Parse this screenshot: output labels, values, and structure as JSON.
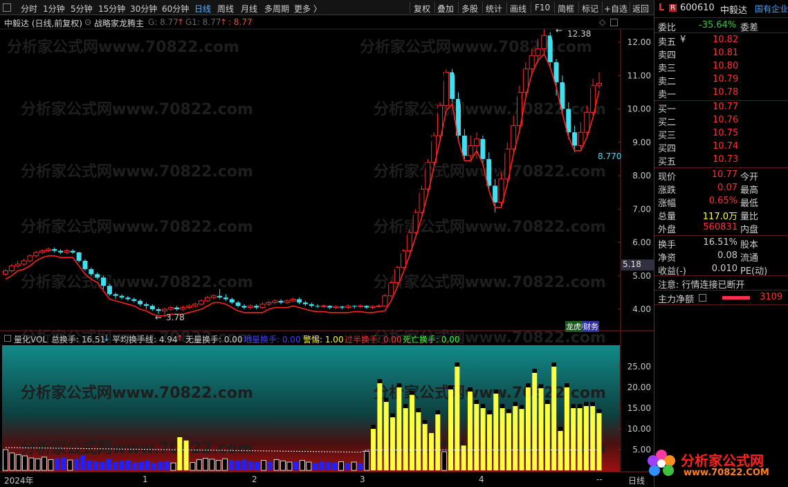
{
  "toolbar": {
    "periods": [
      "分时",
      "1分钟",
      "5分钟",
      "15分钟",
      "30分钟",
      "60分钟",
      "日线",
      "周线",
      "月线",
      "多周期",
      "更多 〉"
    ],
    "active_period": "日线",
    "actions": [
      "复权",
      "叠加",
      "多股",
      "统计",
      "画线",
      "F10",
      "简框",
      "标记",
      "+自选",
      "返回"
    ]
  },
  "chart_header": {
    "stock_label": "中毅达 (日线,前复权)",
    "indicator": "战略家龙腾主",
    "g_label": "G: 8.77",
    "g1_label": "G1: 8.77",
    "third_label": ": 8.77"
  },
  "main_chart": {
    "price_ticks": [
      "12.00",
      "11.00",
      "10.00",
      "9.00",
      "8.00",
      "7.00",
      "6.00",
      "5.00",
      "4.00"
    ],
    "price_ticks_values": [
      12,
      11,
      10,
      9,
      8,
      7,
      6,
      5,
      4
    ],
    "high_label": "12.38",
    "low_label": "3.78",
    "line_label": "8.770",
    "current_price_tag": "5.18",
    "badges": [
      "龙虎榜",
      "财务"
    ],
    "watermark": "分析家公式网www.70822.com",
    "colors": {
      "up": "#ff2a2a",
      "down": "#40e0f0",
      "black_line": "#000000",
      "red_line": "#ff2020"
    }
  },
  "chart_data": [
    {
      "type": "candlestick",
      "ylim": [
        3.6,
        12.8
      ],
      "series": [
        {
          "name": "candles",
          "values": [
            [
              5.05,
              5.15,
              5.2,
              5.0
            ],
            [
              5.15,
              5.3,
              5.35,
              5.1
            ],
            [
              5.3,
              5.35,
              5.45,
              5.25
            ],
            [
              5.35,
              5.45,
              5.5,
              5.3
            ],
            [
              5.45,
              5.6,
              5.65,
              5.4
            ],
            [
              5.6,
              5.7,
              5.75,
              5.55
            ],
            [
              5.7,
              5.75,
              5.8,
              5.65
            ],
            [
              5.75,
              5.8,
              5.85,
              5.7
            ],
            [
              5.8,
              5.75,
              5.85,
              5.7
            ],
            [
              5.75,
              5.7,
              5.8,
              5.65
            ],
            [
              5.7,
              5.75,
              5.8,
              5.65
            ],
            [
              5.75,
              5.7,
              5.8,
              5.65
            ],
            [
              5.7,
              5.45,
              5.72,
              5.4
            ],
            [
              5.45,
              5.2,
              5.5,
              5.15
            ],
            [
              5.2,
              5.05,
              5.25,
              5.0
            ],
            [
              5.05,
              4.95,
              5.1,
              4.9
            ],
            [
              4.95,
              4.7,
              5.0,
              4.6
            ],
            [
              4.7,
              4.45,
              4.75,
              4.4
            ],
            [
              4.45,
              4.4,
              4.5,
              4.3
            ],
            [
              4.4,
              4.35,
              4.45,
              4.3
            ],
            [
              4.35,
              4.3,
              4.4,
              4.25
            ],
            [
              4.3,
              4.25,
              4.35,
              4.2
            ],
            [
              4.25,
              4.15,
              4.3,
              4.1
            ],
            [
              4.15,
              4.1,
              4.2,
              4.0
            ],
            [
              4.1,
              4.0,
              4.15,
              3.95
            ],
            [
              4.0,
              3.95,
              4.05,
              3.85
            ],
            [
              3.95,
              4.0,
              4.05,
              3.78
            ],
            [
              4.0,
              4.05,
              4.1,
              3.95
            ],
            [
              4.05,
              4.0,
              4.1,
              3.95
            ],
            [
              4.0,
              4.05,
              4.1,
              3.95
            ],
            [
              4.05,
              4.1,
              4.15,
              4.0
            ],
            [
              4.1,
              4.15,
              4.2,
              4.05
            ],
            [
              4.15,
              4.25,
              4.3,
              4.1
            ],
            [
              4.25,
              4.35,
              4.4,
              4.2
            ],
            [
              4.35,
              4.4,
              4.45,
              4.3
            ],
            [
              4.4,
              4.35,
              4.6,
              4.3
            ],
            [
              4.35,
              4.3,
              4.45,
              4.25
            ],
            [
              4.3,
              4.2,
              4.35,
              4.15
            ],
            [
              4.2,
              4.1,
              4.25,
              4.05
            ],
            [
              4.1,
              4.05,
              4.15,
              4.0
            ],
            [
              4.05,
              4.1,
              4.15,
              4.0
            ],
            [
              4.1,
              4.05,
              4.15,
              4.0
            ],
            [
              4.05,
              4.15,
              4.2,
              4.0
            ],
            [
              4.15,
              4.2,
              4.25,
              4.1
            ],
            [
              4.2,
              4.25,
              4.3,
              4.15
            ],
            [
              4.25,
              4.2,
              4.3,
              4.15
            ],
            [
              4.2,
              4.25,
              4.3,
              4.15
            ],
            [
              4.25,
              4.3,
              4.35,
              4.2
            ],
            [
              4.3,
              4.2,
              4.35,
              4.15
            ],
            [
              4.2,
              4.15,
              4.25,
              4.1
            ],
            [
              4.15,
              4.1,
              4.2,
              4.05
            ],
            [
              4.1,
              4.08,
              4.15,
              4.03
            ],
            [
              4.08,
              4.1,
              4.15,
              4.03
            ],
            [
              4.1,
              4.05,
              4.12,
              4.0
            ],
            [
              4.05,
              4.08,
              4.12,
              4.0
            ],
            [
              4.08,
              4.05,
              4.1,
              4.0
            ],
            [
              4.05,
              4.1,
              4.15,
              4.0
            ],
            [
              4.1,
              4.08,
              4.12,
              4.02
            ],
            [
              4.08,
              4.1,
              4.15,
              4.03
            ],
            [
              4.1,
              4.05,
              4.12,
              4.0
            ],
            [
              4.05,
              4.08,
              4.12,
              4.0
            ],
            [
              4.08,
              4.1,
              4.15,
              4.05
            ],
            [
              4.1,
              4.4,
              4.45,
              4.08
            ],
            [
              4.4,
              4.8,
              4.85,
              4.35
            ],
            [
              4.8,
              5.25,
              5.3,
              4.75
            ],
            [
              5.25,
              5.75,
              5.8,
              5.2
            ],
            [
              5.75,
              6.3,
              6.4,
              5.7
            ],
            [
              6.3,
              6.9,
              7.0,
              6.25
            ],
            [
              6.9,
              7.6,
              7.7,
              6.85
            ],
            [
              7.6,
              8.4,
              8.5,
              7.5
            ],
            [
              8.4,
              9.2,
              9.3,
              8.3
            ],
            [
              9.2,
              10.1,
              10.2,
              9.1
            ],
            [
              10.1,
              11.1,
              11.2,
              10.0
            ],
            [
              11.1,
              10.3,
              11.2,
              10.2
            ],
            [
              10.3,
              9.2,
              10.5,
              9.0
            ],
            [
              9.2,
              8.6,
              9.4,
              8.5
            ],
            [
              8.6,
              8.9,
              9.2,
              8.4
            ],
            [
              8.9,
              9.1,
              9.3,
              8.5
            ],
            [
              9.1,
              8.5,
              9.2,
              8.3
            ],
            [
              8.5,
              7.7,
              8.7,
              7.6
            ],
            [
              7.7,
              7.2,
              7.9,
              6.9
            ],
            [
              7.2,
              7.9,
              8.1,
              7.1
            ],
            [
              7.9,
              8.8,
              9.0,
              7.8
            ],
            [
              8.8,
              9.5,
              9.8,
              8.7
            ],
            [
              9.5,
              10.5,
              10.7,
              9.4
            ],
            [
              10.5,
              11.2,
              11.4,
              10.3
            ],
            [
              11.2,
              11.6,
              11.8,
              11.0
            ],
            [
              11.6,
              11.8,
              12.1,
              11.4
            ],
            [
              11.8,
              12.2,
              12.38,
              11.6
            ],
            [
              12.2,
              11.4,
              12.3,
              11.2
            ],
            [
              11.4,
              10.8,
              11.5,
              10.4
            ],
            [
              10.8,
              10.0,
              11.0,
              9.8
            ],
            [
              10.0,
              9.3,
              10.2,
              9.1
            ],
            [
              9.3,
              8.9,
              9.5,
              8.7
            ],
            [
              8.9,
              9.3,
              9.6,
              8.8
            ],
            [
              9.3,
              9.9,
              10.1,
              9.2
            ],
            [
              9.9,
              10.7,
              10.9,
              9.8
            ],
            [
              10.7,
              10.77,
              11.1,
              10.6
            ]
          ]
        }
      ]
    },
    {
      "type": "bar",
      "title": "量化VOL",
      "ylim": [
        0,
        30
      ],
      "y_ticks": [
        "25.00",
        "20.00",
        "15.00",
        "10.00",
        "5.00"
      ],
      "y_tick_values": [
        25,
        20,
        15,
        10,
        5
      ],
      "series": [
        {
          "name": "总换手",
          "values": [
            5.0,
            4.2,
            3.8,
            3.5,
            3.0,
            2.8,
            3.2,
            2.6,
            2.9,
            3.1,
            2.5,
            2.8,
            3.6,
            2.4,
            2.2,
            2.0,
            2.8,
            2.1,
            2.3,
            2.5,
            1.9,
            2.1,
            2.4,
            1.8,
            2.0,
            2.2,
            1.8,
            8.0,
            7.2,
            1.9,
            2.6,
            2.9,
            2.7,
            2.4,
            2.8,
            2.5,
            2.3,
            2.6,
            2.2,
            2.0,
            2.4,
            2.1,
            2.6,
            2.3,
            2.0,
            2.1,
            2.4,
            2.0,
            1.8,
            2.2,
            2.0,
            1.9,
            2.1,
            1.8,
            2.0,
            1.7,
            4.6,
            11.0,
            22.0,
            17.5,
            13.8,
            21.0,
            16.0,
            19.2,
            15.0,
            12.2,
            9.0,
            14.5,
            4.5,
            20.5,
            26.0,
            6.0,
            20.0,
            17.0,
            16.0,
            14.5,
            19.5,
            16.0,
            14.8,
            16.5,
            15.8,
            21.0,
            24.5,
            20.8,
            17.0,
            26.0,
            10.5,
            21.0,
            16.0,
            16.0,
            16.5,
            16.5,
            14.8
          ]
        }
      ]
    }
  ],
  "vol_header": {
    "title": "量化VOL",
    "total_turnover": "总换手: 16.51",
    "avg_line": "平均换手线: 4.94",
    "no_volume": "无量换手: 0.00",
    "fast_turnover": "地量换手: 0.00",
    "alert": "警惕: 1.00",
    "over_half": "过半换手: 0.00",
    "dead_turnover": "死亡换手: 0.00"
  },
  "time_axis": {
    "labels": [
      "2024年",
      "1",
      "2",
      "3",
      "4"
    ],
    "dash": "--",
    "tail": "日线"
  },
  "quote_panel": {
    "code_prefix": "L",
    "badge": "R",
    "code": "600610",
    "name": "中毅达",
    "tag": "国有企业",
    "webi_label": "委比",
    "webi_value": "-35.64%",
    "weicha_label": "委差",
    "asks": [
      {
        "label": "卖五",
        "flag": "¥",
        "price": "10.82"
      },
      {
        "label": "卖四",
        "flag": "",
        "price": "10.81"
      },
      {
        "label": "卖三",
        "flag": "",
        "price": "10.80"
      },
      {
        "label": "卖二",
        "flag": "",
        "price": "10.79"
      },
      {
        "label": "卖一",
        "flag": "",
        "price": "10.78"
      }
    ],
    "bids": [
      {
        "label": "买一",
        "price": "10.77"
      },
      {
        "label": "买二",
        "price": "10.76"
      },
      {
        "label": "买三",
        "price": "10.75"
      },
      {
        "label": "买四",
        "price": "10.74"
      },
      {
        "label": "买五",
        "price": "10.73"
      }
    ],
    "stats": [
      {
        "label": "现价",
        "value": "10.77",
        "label2": "今开"
      },
      {
        "label": "涨跌",
        "value": "0.07",
        "label2": "最高"
      },
      {
        "label": "涨幅",
        "value": "0.65%",
        "label2": "最低"
      },
      {
        "label": "总量",
        "value": "117.0万",
        "label2": "量比"
      },
      {
        "label": "外盘",
        "value": "560831",
        "label2": "内盘"
      }
    ],
    "stats2": [
      {
        "label": "换手",
        "value": "16.51%",
        "label2": "股本"
      },
      {
        "label": "净资",
        "value": "0.08",
        "label2": "流通"
      },
      {
        "label": "收益(-)",
        "value": "0.010",
        "label2": "PE(动)"
      }
    ],
    "notice": "注意: 行情连接已断开",
    "main_net_label": "主力净额",
    "main_net_value": "3109"
  },
  "logo": {
    "text": "分析家公式网",
    "url": "www.70822.COM"
  }
}
